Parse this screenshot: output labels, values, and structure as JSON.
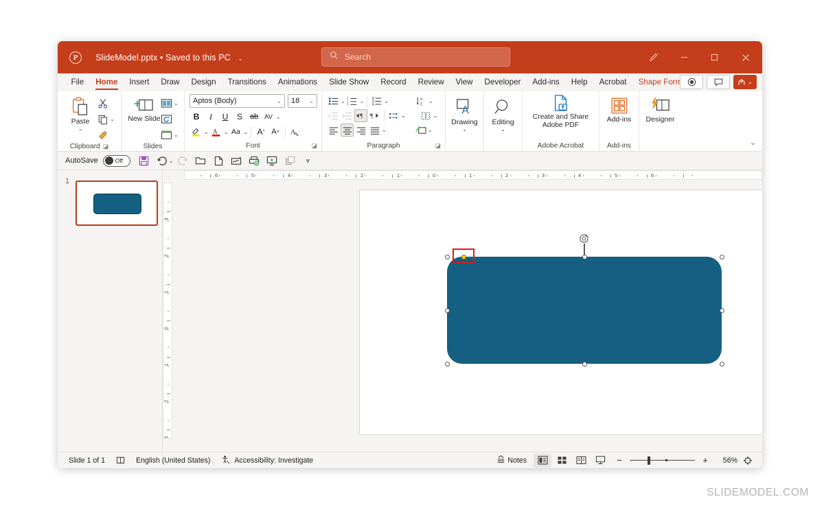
{
  "window": {
    "title": "SlideModel.pptx",
    "separator": "•",
    "save_state": "Saved to this PC",
    "app_icon": "powerpoint-logo-icon"
  },
  "search": {
    "placeholder": "Search"
  },
  "title_controls": {
    "pen": "pen-icon",
    "minimize": "—",
    "maximize": "▢",
    "close": "✕"
  },
  "tabs": [
    {
      "label": "File",
      "active": false
    },
    {
      "label": "Home",
      "active": true
    },
    {
      "label": "Insert",
      "active": false
    },
    {
      "label": "Draw",
      "active": false
    },
    {
      "label": "Design",
      "active": false
    },
    {
      "label": "Transitions",
      "active": false
    },
    {
      "label": "Animations",
      "active": false
    },
    {
      "label": "Slide Show",
      "active": false
    },
    {
      "label": "Record",
      "active": false
    },
    {
      "label": "Review",
      "active": false
    },
    {
      "label": "View",
      "active": false
    },
    {
      "label": "Developer",
      "active": false
    },
    {
      "label": "Add-ins",
      "active": false
    },
    {
      "label": "Help",
      "active": false
    },
    {
      "label": "Acrobat",
      "active": false
    },
    {
      "label": "Shape Format",
      "active": false,
      "contextual": true
    }
  ],
  "ribbon": {
    "groups": {
      "clipboard": {
        "label": "Clipboard",
        "paste": "Paste",
        "cut": "scissors-icon",
        "copy": "copy-icon",
        "format_painter": "format-painter-icon",
        "dialog_launcher": "⌐"
      },
      "slides": {
        "label": "Slides",
        "new_slide": "New Slide",
        "layout": "layout-icon",
        "reset": "reset-icon",
        "section": "section-icon"
      },
      "font": {
        "label": "Font",
        "font_name": "Aptos (Body)",
        "font_size": "18",
        "bold": "B",
        "italic": "I",
        "underline": "U",
        "shadow": "S",
        "strikethrough": "ab",
        "character_spacing": "AV",
        "text_highlight": "text-highlight-icon",
        "font_color": "A",
        "change_case": "Aa",
        "increase_size": "A",
        "decrease_size": "A",
        "clear_formatting": "clear-formatting-icon",
        "dialog_launcher": "⌐"
      },
      "paragraph": {
        "label": "Paragraph",
        "bullets": "bullets-icon",
        "numbering": "numbering-icon",
        "line_spacing": "line-spacing-icon",
        "text_direction": "text-direction-icon",
        "decrease_indent": "decrease-indent-icon",
        "increase_indent": "increase-indent-icon",
        "rtl": "rtl-icon",
        "ltr": "ltr-icon",
        "columns": "columns-icon",
        "align_text": "align-text-icon",
        "align_left": "align-left-icon",
        "align_center": "align-center-icon",
        "align_right": "align-right-icon",
        "justify": "justify-icon",
        "smartart": "smartart-icon",
        "dialog_launcher": "⌐"
      },
      "drawing": {
        "label": "Drawing"
      },
      "editing": {
        "label": "Editing"
      },
      "acrobat": {
        "label": "Adobe Acrobat",
        "button": "Create and Share Adobe PDF"
      },
      "addins": {
        "label": "Add-ins",
        "button": "Add-ins"
      },
      "designer": {
        "label": "Designer"
      }
    },
    "collapse": "collapse-ribbon-icon"
  },
  "qat": {
    "autosave_label": "AutoSave",
    "autosave_state": "Off",
    "buttons": [
      "save-icon",
      "undo-icon",
      "undo-caret",
      "redo-icon",
      "open-icon",
      "new-icon",
      "signature-icon",
      "print-icon",
      "start-slideshow-icon",
      "duplicate-icon",
      "customize-qat-icon"
    ]
  },
  "thumbnails": {
    "slides": [
      {
        "number": "1"
      }
    ]
  },
  "ruler": {
    "horizontal_left": [
      "6",
      "5",
      "4",
      "3",
      "2",
      "1"
    ],
    "horizontal_center": "0",
    "horizontal_right": [
      "1",
      "2",
      "3",
      "4",
      "5",
      "6"
    ],
    "vertical_top": [
      "3",
      "2",
      "1"
    ],
    "vertical_center": "0",
    "vertical_bottom": [
      "1",
      "2",
      "3"
    ]
  },
  "slide": {
    "shape": {
      "name": "rounded-rectangle",
      "fill_color": "#156082",
      "adjustment_handle_color": "#ffd400",
      "highlight_color": "#ee1111"
    }
  },
  "status_bar": {
    "slide_counter": "Slide 1 of 1",
    "notes_icon": "slide-notes-icon",
    "language": "English (United States)",
    "accessibility_icon": "accessibility-icon",
    "accessibility": "Accessibility: Investigate",
    "notes_button": "Notes",
    "views": [
      "normal-view-icon",
      "slide-sorter-icon",
      "reading-view-icon",
      "slideshow-icon"
    ],
    "zoom_out": "−",
    "zoom_in": "+",
    "zoom_level": "56%",
    "fit_slide": "fit-slide-icon"
  },
  "watermark": {
    "text": "SLIDEMODEL.COM"
  },
  "colors": {
    "brand": "#c43e1c",
    "shape_fill": "#156082",
    "accent_red": "#ee1111",
    "handle_yellow": "#ffd400"
  }
}
